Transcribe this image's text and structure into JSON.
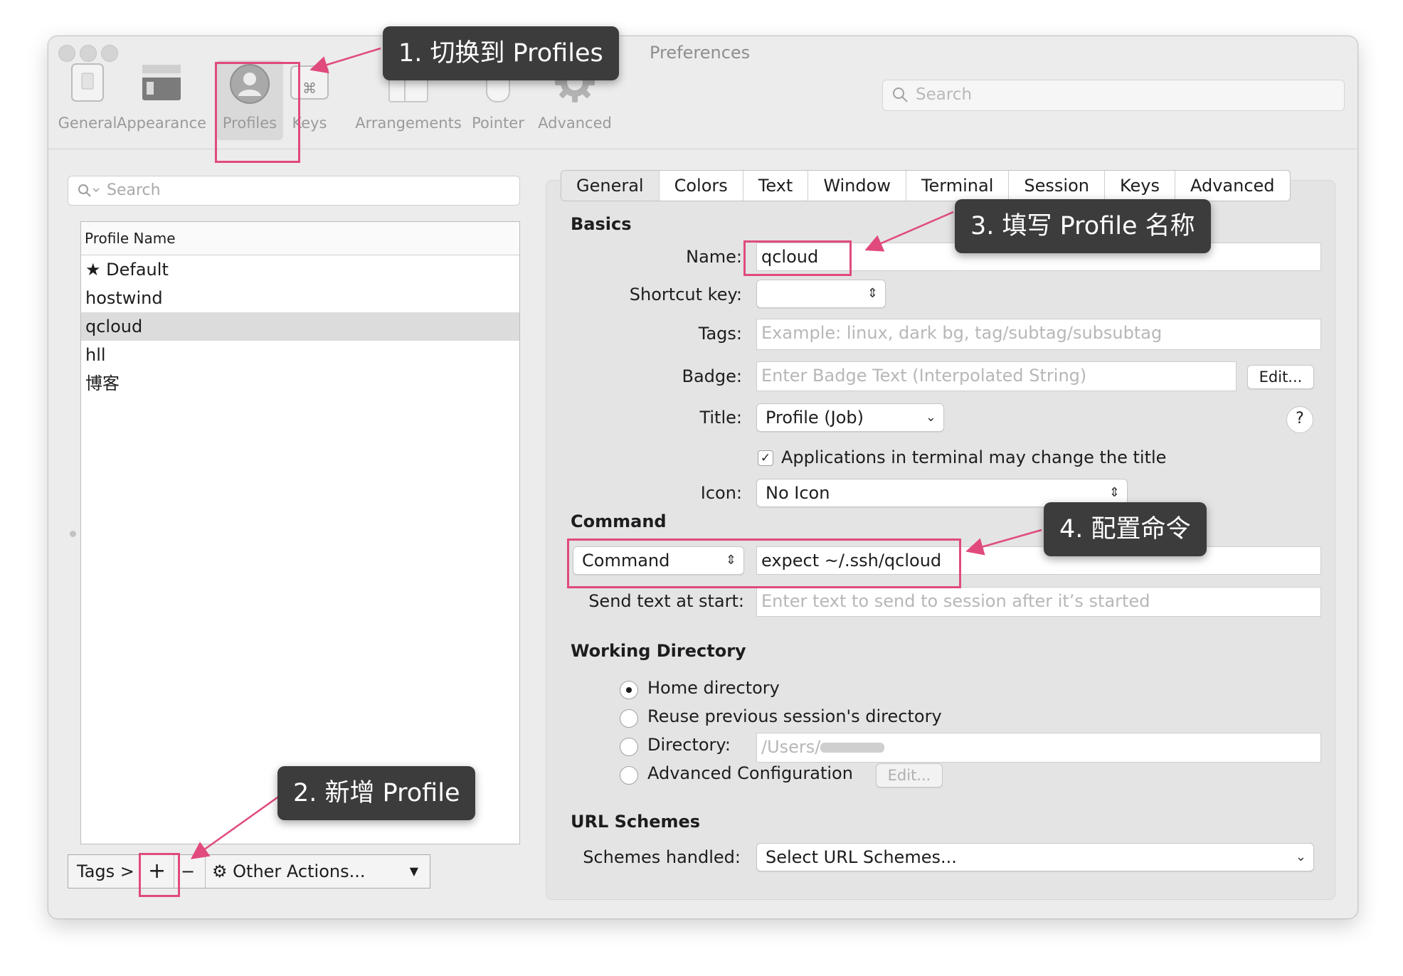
{
  "window": {
    "title": "Preferences"
  },
  "toolbar": {
    "items": [
      {
        "label": "General",
        "icon": "general-icon"
      },
      {
        "label": "Appearance",
        "icon": "appearance-icon"
      },
      {
        "label": "Profiles",
        "icon": "profile-person-icon"
      },
      {
        "label": "Keys",
        "icon": "command-key-icon"
      },
      {
        "label": "Arrangements",
        "icon": "arrangements-icon"
      },
      {
        "label": "Pointer",
        "icon": "mouse-icon"
      },
      {
        "label": "Advanced",
        "icon": "gear-icon"
      }
    ],
    "search_placeholder": "Search"
  },
  "profiles": {
    "search_placeholder": "Search",
    "column_header": "Profile Name",
    "items": [
      {
        "name": "Default",
        "default": true
      },
      {
        "name": "hostwind"
      },
      {
        "name": "qcloud",
        "selected": true
      },
      {
        "name": "hll"
      },
      {
        "name": "博客"
      }
    ],
    "bottom": {
      "tags": "Tags >",
      "add": "+",
      "remove": "−",
      "other_actions": "Other Actions..."
    }
  },
  "tabs": [
    "General",
    "Colors",
    "Text",
    "Window",
    "Terminal",
    "Session",
    "Keys",
    "Advanced"
  ],
  "basics": {
    "heading": "Basics",
    "name_label": "Name:",
    "name_value": "qcloud",
    "shortcut_label": "Shortcut key:",
    "tags_label": "Tags:",
    "tags_placeholder": "Example: linux, dark bg, tag/subtag/subsubtag",
    "badge_label": "Badge:",
    "badge_placeholder": "Enter Badge Text (Interpolated String)",
    "badge_edit": "Edit...",
    "title_label": "Title:",
    "title_value": "Profile (Job)",
    "help": "?",
    "apps_change_title": "Applications in terminal may change the title",
    "icon_label": "Icon:",
    "icon_value": "No Icon"
  },
  "command": {
    "heading": "Command",
    "type": "Command",
    "value": "expect ~/.ssh/qcloud",
    "send_text_label": "Send text at start:",
    "send_text_placeholder": "Enter text to send to session after it’s started"
  },
  "working_directory": {
    "heading": "Working Directory",
    "options": [
      "Home directory",
      "Reuse previous session's directory",
      "Directory:",
      "Advanced Configuration"
    ],
    "directory_value": "/Users/",
    "edit": "Edit..."
  },
  "url_schemes": {
    "heading": "URL Schemes",
    "label": "Schemes handled:",
    "value": "Select URL Schemes..."
  },
  "annotations": {
    "step1": "1. 切换到 Profiles",
    "step2": "2. 新增 Profile",
    "step3": "3. 填写 Profile 名称",
    "step4": "4. 配置命令",
    "highlight_color": "#e04a7d"
  }
}
